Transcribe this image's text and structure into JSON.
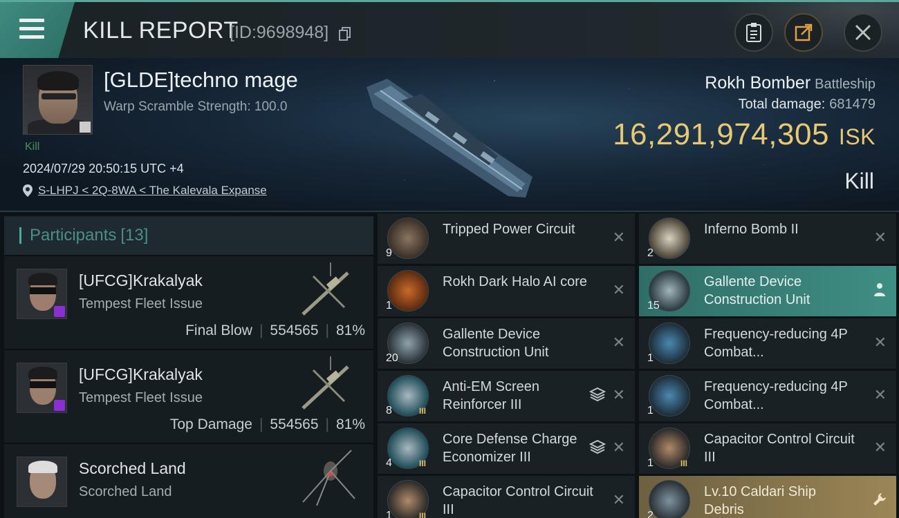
{
  "header": {
    "title": "KILL REPORT",
    "report_id": "[ID:9698948]",
    "icons": {
      "menu": "menu-icon",
      "copy": "copy-icon",
      "clipboard": "clipboard-icon",
      "share": "share-icon",
      "close": "close-icon"
    }
  },
  "victim": {
    "name": "[GLDE]techno mage",
    "subtitle": "Warp Scramble Strength: 100.0",
    "kill_tag": "Kill",
    "timestamp": "2024/07/29 20:50:15 UTC +4",
    "location": "S-LHPJ < 2Q-8WA < The Kalevala Expanse",
    "ship_name": "Rokh Bomber",
    "ship_class": "Battleship",
    "total_damage_label": "Total damage:",
    "total_damage": "681479",
    "isk_value": "16,291,974,305",
    "isk_unit": "ISK",
    "result": "Kill"
  },
  "participants": {
    "label": "Participants",
    "count": "[13]",
    "rows": [
      {
        "name": "[UFCG]Krakalyak",
        "ship": "Tempest Fleet Issue",
        "role": "Final Blow",
        "damage": "554565",
        "percent": "81%"
      },
      {
        "name": "[UFCG]Krakalyak",
        "ship": "Tempest Fleet Issue",
        "role": "Top Damage",
        "damage": "554565",
        "percent": "81%"
      },
      {
        "name": "Scorched Land",
        "ship": "Scorched Land",
        "role": "",
        "damage": "",
        "percent": ""
      }
    ]
  },
  "items_left": [
    {
      "qty": "9",
      "name": "Tripped Power Circuit"
    },
    {
      "qty": "1",
      "name": "Rokh Dark Halo AI core"
    },
    {
      "qty": "20",
      "name": "Gallente Device Construction Unit"
    },
    {
      "qty": "8",
      "name": "Anti-EM Screen Reinforcer III"
    },
    {
      "qty": "4",
      "name": "Core Defense Charge Economizer III"
    },
    {
      "qty": "1",
      "name": "Capacitor Control Circuit III"
    }
  ],
  "items_right": [
    {
      "qty": "2",
      "name": "Inferno Bomb II"
    },
    {
      "qty": "15",
      "name": "Gallente Device Construction Unit"
    },
    {
      "qty": "1",
      "name": "Frequency-reducing 4P Combat..."
    },
    {
      "qty": "1",
      "name": "Frequency-reducing 4P Combat..."
    },
    {
      "qty": "1",
      "name": "Capacitor Control Circuit III"
    },
    {
      "qty": "2",
      "name": "Lv.10 Caldari Ship Debris"
    }
  ],
  "colors": {
    "accent": "#4fa89c",
    "isk": "#e8c873",
    "highlight_teal": "#3f8e84",
    "highlight_gold": "#9a8656",
    "rank_badge": "#e6c060"
  }
}
